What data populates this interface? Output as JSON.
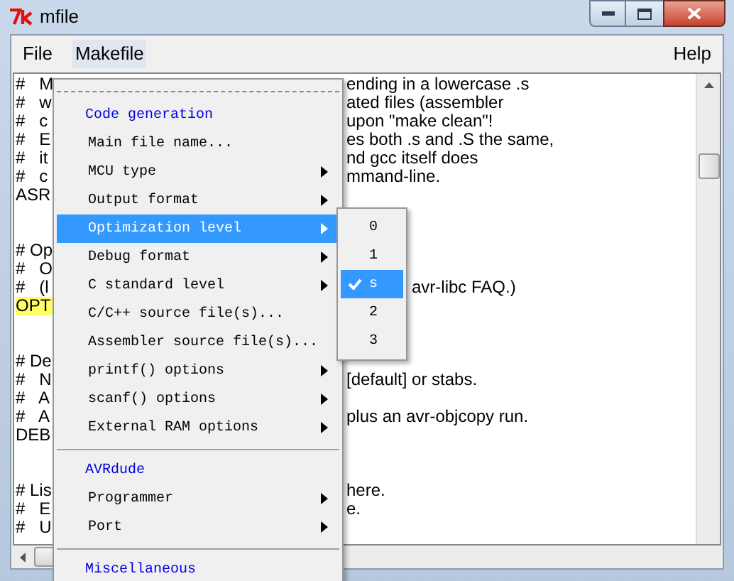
{
  "window": {
    "title": "mfile"
  },
  "menubar": [
    {
      "label": "File",
      "open": false
    },
    {
      "label": "Makefile",
      "open": true
    },
    {
      "label": "Help",
      "open": false
    }
  ],
  "editor": {
    "lines": [
      {
        "left": "#   M",
        "right": "ending in a lowercase .s",
        "highlighted": false
      },
      {
        "left": "#   w",
        "right": "ated files (assembler",
        "highlighted": false
      },
      {
        "left": "#   c",
        "right": "upon \"make clean\"!",
        "highlighted": false
      },
      {
        "left": "#   E",
        "right": "es both .s and .S the same,",
        "highlighted": false
      },
      {
        "left": "#   it",
        "right": "nd gcc itself does",
        "highlighted": false
      },
      {
        "left": "#   c",
        "right": "mmand-line.",
        "highlighted": false
      },
      {
        "left": "ASR",
        "highlighted": false
      },
      {
        "highlighted": false
      },
      {
        "highlighted": false
      },
      {
        "left": "# Op",
        "highlighted": false
      },
      {
        "left": "#   O",
        "highlighted": false
      },
      {
        "left": "#   (l",
        "right": "avr-libc FAQ.)",
        "highlighted": false
      },
      {
        "left": "OPT",
        "highlighted": true
      },
      {
        "highlighted": false
      },
      {
        "highlighted": false
      },
      {
        "left": "# De",
        "highlighted": false
      },
      {
        "left": "#   N",
        "right": "[default] or stabs.",
        "highlighted": false
      },
      {
        "left": "#   A",
        "highlighted": false
      },
      {
        "left": "#   A",
        "right": "plus an avr-objcopy run.",
        "highlighted": false
      },
      {
        "left": "DEB",
        "highlighted": false
      },
      {
        "highlighted": false
      },
      {
        "highlighted": false
      },
      {
        "left": "# Lis",
        "right": "here.",
        "highlighted": false
      },
      {
        "left": "#   E",
        "right": "e.",
        "highlighted": false
      },
      {
        "left": "#   U",
        "highlighted": false
      }
    ]
  },
  "menu": {
    "items": [
      {
        "kind": "tearoff"
      },
      {
        "kind": "header",
        "label": "Code generation"
      },
      {
        "kind": "item",
        "label": "Main file name...",
        "selected": false
      },
      {
        "kind": "submenu",
        "label": "MCU type",
        "selected": false
      },
      {
        "kind": "submenu",
        "label": "Output format",
        "selected": false
      },
      {
        "kind": "submenu",
        "label": "Optimization level",
        "selected": true
      },
      {
        "kind": "submenu",
        "label": "Debug format",
        "selected": false
      },
      {
        "kind": "submenu",
        "label": "C standard level",
        "selected": false
      },
      {
        "kind": "item",
        "label": "C/C++ source file(s)...",
        "selected": false
      },
      {
        "kind": "item",
        "label": "Assembler source file(s)...",
        "selected": false
      },
      {
        "kind": "submenu",
        "label": "printf() options",
        "selected": false
      },
      {
        "kind": "submenu",
        "label": "scanf() options",
        "selected": false
      },
      {
        "kind": "submenu",
        "label": "External RAM options",
        "selected": false
      },
      {
        "kind": "separator"
      },
      {
        "kind": "header",
        "label": "AVRdude"
      },
      {
        "kind": "submenu",
        "label": "Programmer",
        "selected": false
      },
      {
        "kind": "submenu",
        "label": "Port",
        "selected": false
      },
      {
        "kind": "separator"
      },
      {
        "kind": "header",
        "label": "Miscellaneous"
      }
    ]
  },
  "submenu": {
    "items": [
      {
        "label": "0",
        "selected": false,
        "checked": false
      },
      {
        "label": "1",
        "selected": false,
        "checked": false
      },
      {
        "label": "s",
        "selected": true,
        "checked": true
      },
      {
        "label": "2",
        "selected": false,
        "checked": false
      },
      {
        "label": "3",
        "selected": false,
        "checked": false
      }
    ]
  }
}
